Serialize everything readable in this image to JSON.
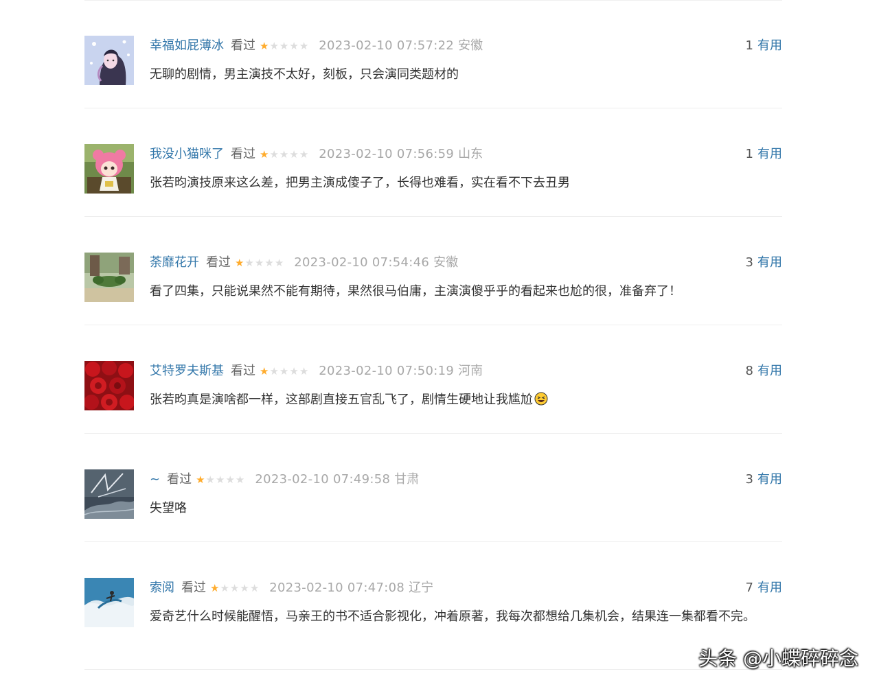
{
  "comments": [
    {
      "username": "幸福如屁薄冰",
      "status": "看过",
      "rating": 1,
      "max_rating": 5,
      "time": "2023-02-10 07:57:22",
      "location": "安徽",
      "votes": "1",
      "vote_label": "有用",
      "content": "无聊的剧情，男主演技不太好，刻板，只会演同类题材的",
      "avatar": "avatar-anime-girl-icon"
    },
    {
      "username": "我没小猫咪了",
      "status": "看过",
      "rating": 1,
      "max_rating": 5,
      "time": "2023-02-10 07:56:59",
      "location": "山东",
      "votes": "1",
      "vote_label": "有用",
      "content": "张若昀演技原来这么差，把男主演成傻子了，长得也难看，实在看不下去丑男",
      "avatar": "avatar-pink-doll-icon"
    },
    {
      "username": "荼靡花开",
      "status": "看过",
      "rating": 1,
      "max_rating": 5,
      "time": "2023-02-10 07:54:46",
      "location": "安徽",
      "votes": "3",
      "vote_label": "有用",
      "content": "看了四集，只能说果然不能有期待，果然很马伯庸，主演演傻乎乎的看起来也尬的很，准备弃了！",
      "avatar": "avatar-garden-icon"
    },
    {
      "username": "艾特罗夫斯基",
      "status": "看过",
      "rating": 1,
      "max_rating": 5,
      "time": "2023-02-10 07:50:19",
      "location": "河南",
      "votes": "8",
      "vote_label": "有用",
      "content": "张若昀真是演啥都一样，这部剧直接五官乱飞了，剧情生硬地让我尴尬",
      "has_emoji": true,
      "avatar": "avatar-red-roses-icon"
    },
    {
      "username": "~",
      "status": "看过",
      "rating": 1,
      "max_rating": 5,
      "time": "2023-02-10 07:49:58",
      "location": "甘肃",
      "votes": "3",
      "vote_label": "有用",
      "content": "失望咯",
      "avatar": "avatar-dark-sketch-icon"
    },
    {
      "username": "索阅",
      "status": "看过",
      "rating": 1,
      "max_rating": 5,
      "time": "2023-02-10 07:47:08",
      "location": "辽宁",
      "votes": "7",
      "vote_label": "有用",
      "content": "爱奇艺什么时候能醒悟，马亲王的书不适合影视化，冲着原著，我每次都想给几集机会，结果连一集都看不完。",
      "avatar": "avatar-surfer-icon"
    }
  ],
  "watermark": "头条 @小蝶碎碎念",
  "colors": {
    "username": "#3377aa",
    "star_on": "#ffac2d",
    "star_off": "#dddddd",
    "meta_gray": "#a8a8a8",
    "text": "#333333",
    "divider": "#eeeeee"
  }
}
